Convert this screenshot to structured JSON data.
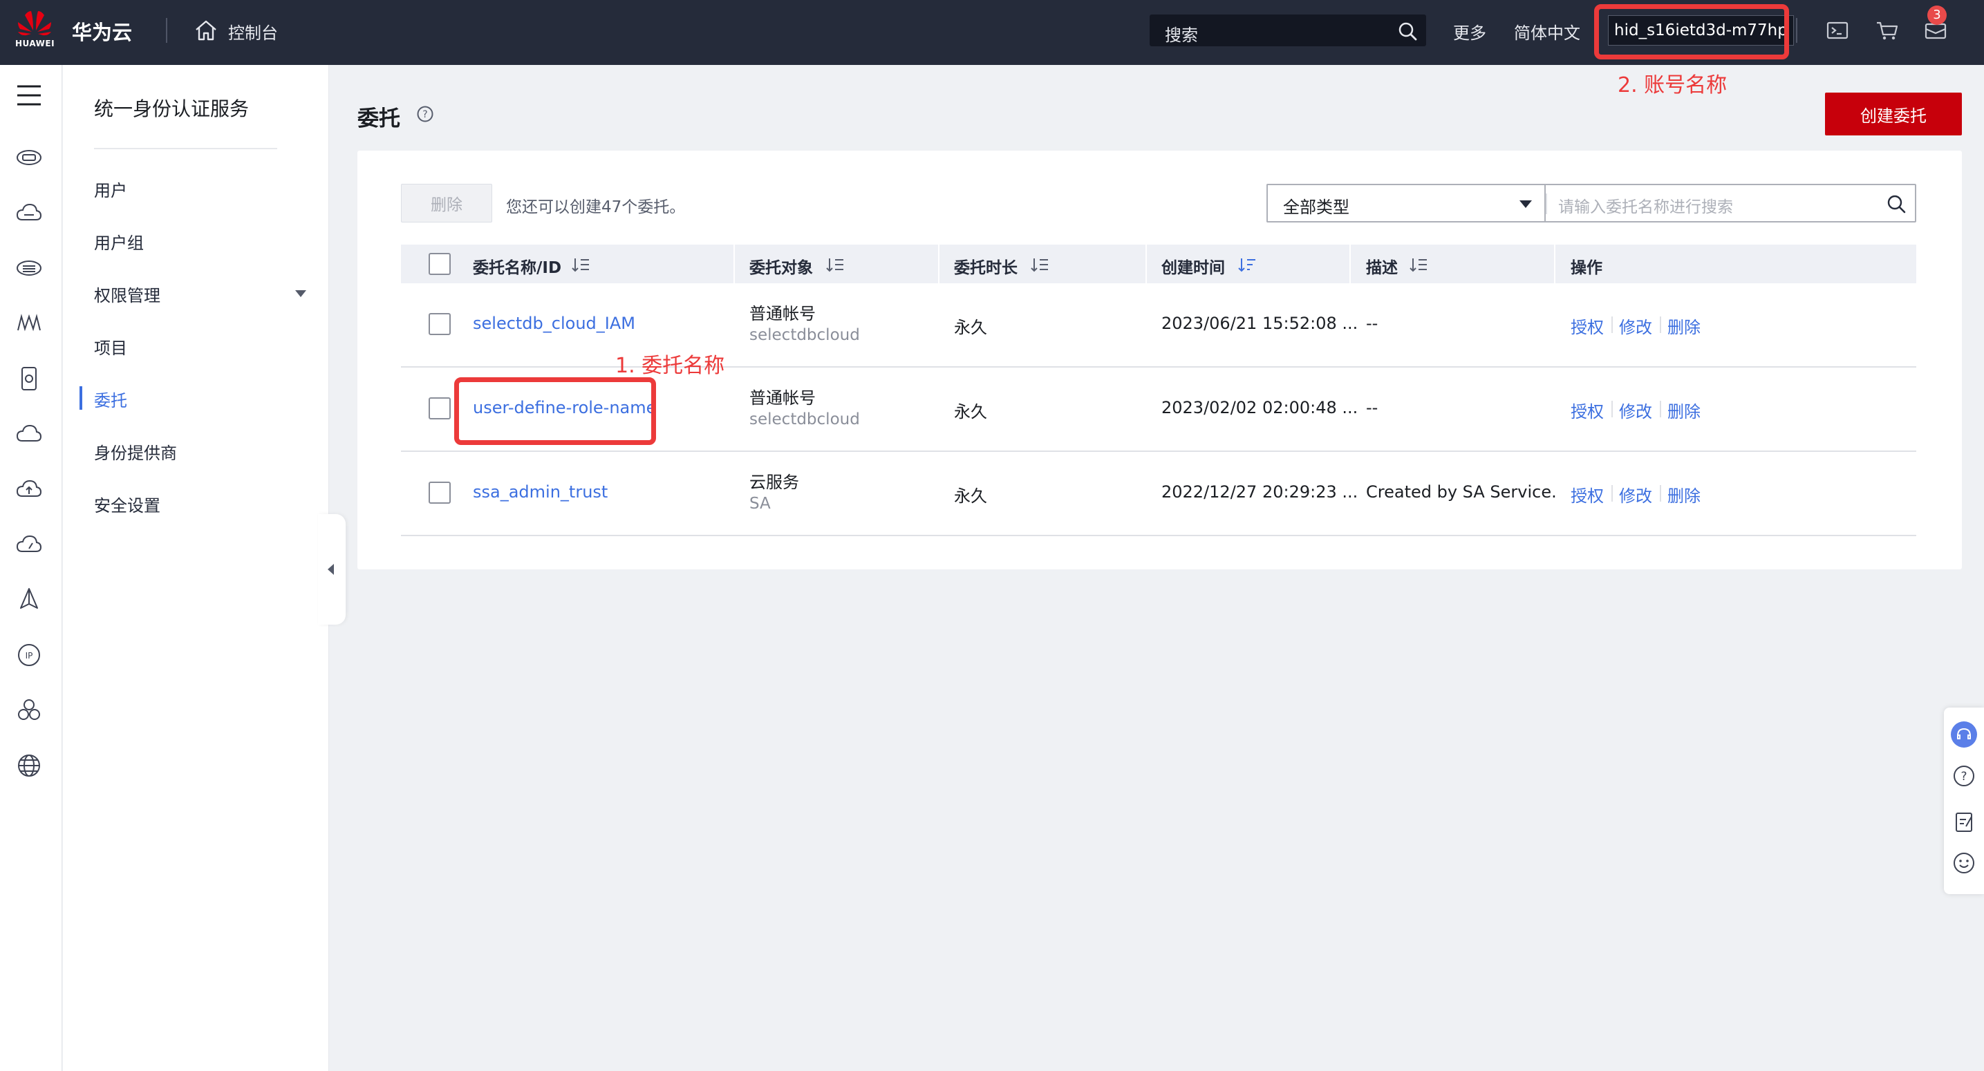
{
  "topbar": {
    "logo_text": "HUAWEI",
    "brand": "华为云",
    "console": "控制台",
    "search_placeholder": "搜索",
    "more": "更多",
    "language": "简体中文",
    "account": "hid_s16ietd3d-m77hp",
    "notification_count": "3"
  },
  "annotations": {
    "agency_name": "1. 委托名称",
    "account_name": "2. 账号名称"
  },
  "rail_icons": [
    "menu-icon",
    "storage-icon",
    "cloud-icon",
    "database-icon",
    "monitor-icon",
    "device-icon",
    "cloud-sync-icon",
    "cloud-upload-icon",
    "cloud-speed-icon",
    "deploy-icon",
    "ip-icon",
    "cluster-icon",
    "globe-icon"
  ],
  "subnav": {
    "title": "统一身份认证服务",
    "items": [
      {
        "label": "用户"
      },
      {
        "label": "用户组"
      },
      {
        "label": "权限管理"
      },
      {
        "label": "项目"
      },
      {
        "label": "委托"
      },
      {
        "label": "身份提供商"
      },
      {
        "label": "安全设置"
      }
    ]
  },
  "page": {
    "title": "委托",
    "create_button": "创建委托",
    "delete_button": "删除",
    "quota_text": "您还可以创建47个委托。",
    "type_filter": "全部类型",
    "search_placeholder": "请输入委托名称进行搜索"
  },
  "table": {
    "columns": [
      "委托名称/ID",
      "委托对象",
      "委托时长",
      "创建时间",
      "描述",
      "操作"
    ],
    "rows": [
      {
        "name": "selectdb_cloud_IAM",
        "target": "普通帐号",
        "target_sub": "selectdbcloud",
        "duration": "永久",
        "created": "2023/06/21 15:52:08 ...",
        "desc": "--",
        "ops": [
          "授权",
          "修改",
          "删除"
        ]
      },
      {
        "name": "user-define-role-name",
        "target": "普通帐号",
        "target_sub": "selectdbcloud",
        "duration": "永久",
        "created": "2023/02/02 02:00:48 ...",
        "desc": "--",
        "ops": [
          "授权",
          "修改",
          "删除"
        ]
      },
      {
        "name": "ssa_admin_trust",
        "target": "云服务",
        "target_sub": "SA",
        "duration": "永久",
        "created": "2022/12/27 20:29:23 ...",
        "desc": "Created by SA Service.",
        "ops": [
          "授权",
          "修改",
          "删除"
        ]
      }
    ]
  },
  "colors": {
    "topbar": "#252b3a",
    "brand_red": "#c7000b",
    "link_blue": "#3c6fe0",
    "annotation_red": "#ec3a3a"
  }
}
